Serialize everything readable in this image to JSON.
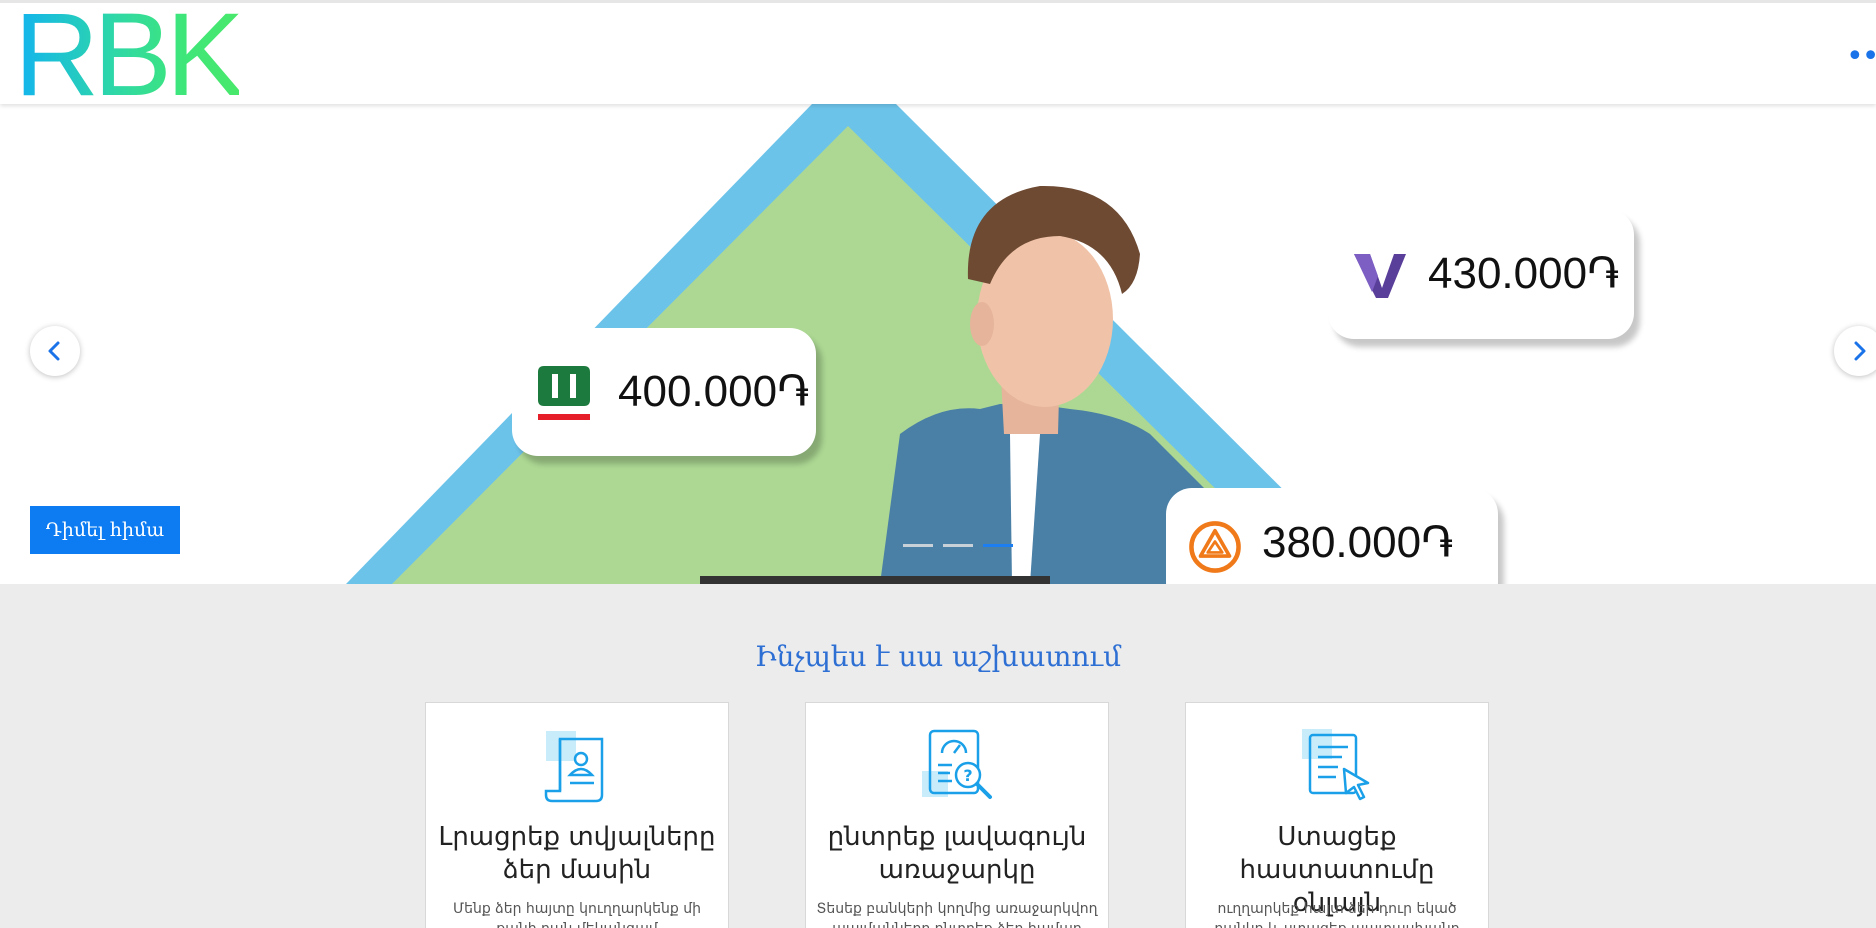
{
  "header": {
    "logo_text": "RBK",
    "menu_icon": "more-dots-icon"
  },
  "hero": {
    "offers": [
      {
        "bank_icon": "acba-bank-logo",
        "amount": "400.000֏"
      },
      {
        "bank_icon": "vtb-bank-logo",
        "amount": "430.000֏"
      },
      {
        "bank_icon": "ameria-bank-logo",
        "amount": "380.000֏"
      }
    ],
    "apply_button": "Դիմել հիմա",
    "slider": {
      "count": 3,
      "active_index": 2
    },
    "prev_icon": "chevron-left-icon",
    "next_icon": "chevron-right-icon"
  },
  "how_it_works": {
    "title": "Ինչպես է սա աշխատում",
    "steps": [
      {
        "icon": "form-document-icon",
        "title": "Լրացրեք տվյալները ձեր մասին",
        "desc": "Մենք ձեր հայտը կուղղարկենք մի քանի բան մեկանգամ"
      },
      {
        "icon": "report-search-icon",
        "title": "ընտրեք լավագույն առաջարկը",
        "desc": "Տեսեք բանկերի կողմից առաջարկվող պայմանները ընտրեք ձեր համար"
      },
      {
        "icon": "document-click-icon",
        "title": "Ստացեք հաստատումը օնլայն",
        "desc": "ուղղարկեք հայտ ձեր դուր եկած բանկը և ստացեք պատասխանը րոպեներ"
      }
    ]
  },
  "colors": {
    "accent": "#0d7cf2",
    "title_blue": "#2e6fd4",
    "triangle_green": "#acd893",
    "triangle_blue": "#6cc3ea"
  }
}
